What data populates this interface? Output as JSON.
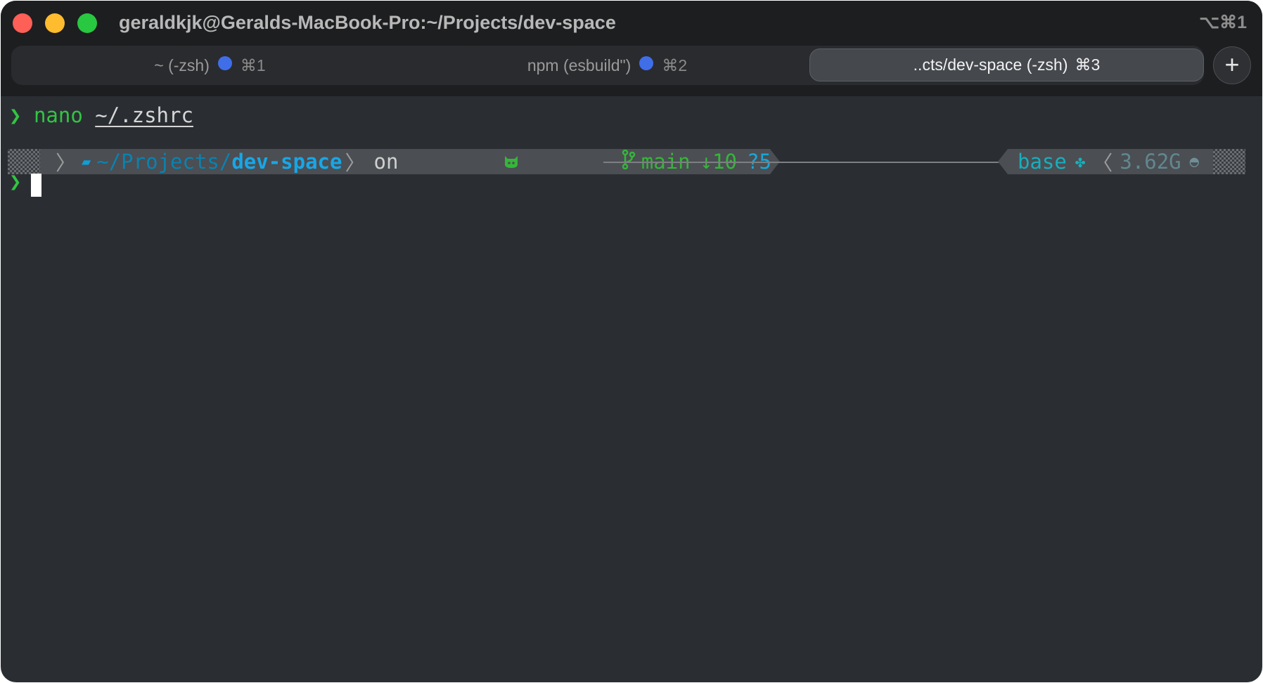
{
  "window": {
    "title": "geraldkjk@Geralds-MacBook-Pro:~/Projects/dev-space",
    "shortcut": "⌥⌘1"
  },
  "tabs": [
    {
      "label": "~ (-zsh)",
      "shortcut": "⌘1",
      "has_dot": true,
      "active": false
    },
    {
      "label": "npm (esbuild\")",
      "shortcut": "⌘2",
      "has_dot": true,
      "active": false
    },
    {
      "label": "..cts/dev-space (-zsh)",
      "shortcut": "⌘3",
      "has_dot": false,
      "active": true
    }
  ],
  "new_tab_label": "+",
  "terminal": {
    "prompt_symbol": "❯",
    "command": "nano",
    "command_arg": "~/.zshrc",
    "prompt": {
      "path_prefix": "~/Projects/",
      "path_current": "dev-space",
      "on_label": "on",
      "branch": "main",
      "ahead": "↓10",
      "untracked": "?5",
      "env": "base",
      "memory": "3.62G"
    }
  },
  "colors": {
    "terminal_bg": "#2a2e33",
    "titlebar_bg": "#1d1e20",
    "prompt_green": "#33c443",
    "path_blue": "#18a6e6",
    "tab_dot": "#3f6ee8"
  },
  "icons": [
    "apple-icon",
    "folder-icon",
    "github-cat-icon",
    "git-branch-icon",
    "python-icon",
    "gauge-icon"
  ]
}
